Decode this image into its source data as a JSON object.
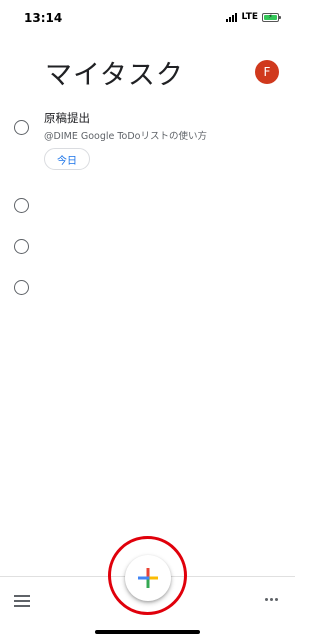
{
  "status_bar": {
    "time": "13:14",
    "network": "LTE",
    "signal_icon": "cellular-signal-icon",
    "battery_icon": "battery-charging-icon"
  },
  "header": {
    "title": "マイタスク",
    "avatar_initial": "F",
    "avatar_color": "#d0391d"
  },
  "tasks": [
    {
      "title": "原稿提出",
      "subtitle": "@DIME Google ToDoリストの使い方",
      "date_chip": "今日",
      "completed": false
    },
    {
      "title": "",
      "completed": false
    },
    {
      "title": "",
      "completed": false
    },
    {
      "title": "",
      "completed": false
    }
  ],
  "bottom_bar": {
    "menu_icon": "hamburger-menu-icon",
    "more_icon": "more-horizontal-icon"
  },
  "fab": {
    "icon": "plus-icon",
    "colors": {
      "top": "#ea4335",
      "left": "#4285f4",
      "right": "#fbbc04",
      "bottom": "#34a853"
    },
    "highlight_color": "#e0000b"
  }
}
